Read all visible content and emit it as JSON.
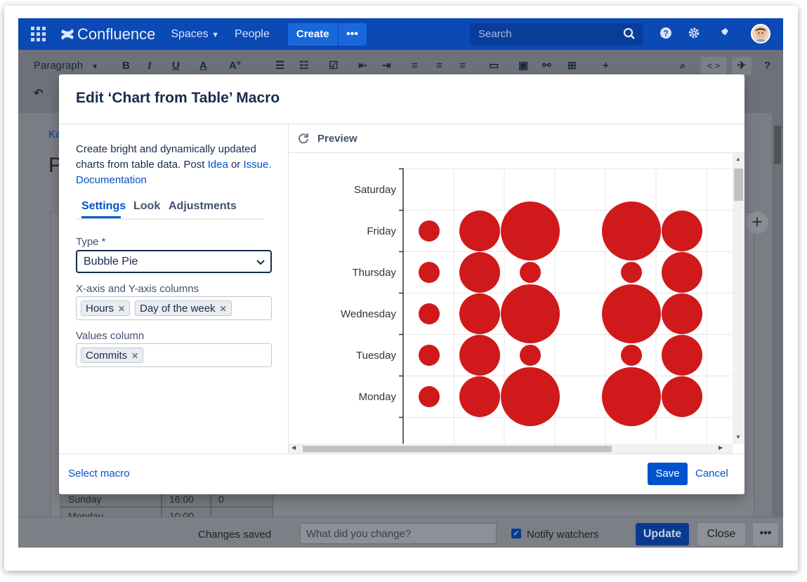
{
  "topnav": {
    "brand": "Confluence",
    "spaces": "Spaces",
    "people": "People",
    "create": "Create",
    "more": "•••",
    "search_placeholder": "Search"
  },
  "toolbar": {
    "paragraph": "Paragraph",
    "bold": "B",
    "italic": "I",
    "underline": "U",
    "color": "A",
    "code": "< >",
    "help": "?"
  },
  "page": {
    "breadcrumb_fragment": "Ka",
    "title_fragment": "P",
    "table_fragment": [
      {
        "day": "Sunday",
        "hours": "16:00",
        "commits": "0"
      },
      {
        "day": "Monday",
        "hours": "10:00",
        "commits": "..."
      }
    ]
  },
  "bottombar": {
    "changes_saved": "Changes saved",
    "comment_placeholder": "What did you change?",
    "notify": "Notify watchers",
    "update": "Update",
    "close": "Close",
    "more": "•••"
  },
  "modal": {
    "title": "Edit ‘Chart from Table’ Macro",
    "description_pre": "Create bright and dynamically updated charts from table data. Post ",
    "idea_link": "Idea",
    "desc_or": " or ",
    "issue_link": "Issue.",
    "documentation_link": "Documentation",
    "tabs": [
      "Settings",
      "Look",
      "Adjustments"
    ],
    "type_label": "Type *",
    "type_value": "Bubble Pie",
    "axes_label": "X-axis and Y-axis columns",
    "axes_tags": [
      "Hours",
      "Day of the week"
    ],
    "values_label": "Values column",
    "values_tags": [
      "Commits"
    ],
    "preview": "Preview",
    "select_macro": "Select macro",
    "save": "Save",
    "cancel": "Cancel"
  },
  "chart_data": {
    "type": "scatter",
    "variant": "bubble",
    "categories": [
      "Monday",
      "Tuesday",
      "Wednesday",
      "Thursday",
      "Friday",
      "Saturday"
    ],
    "bubble_color": "#d0191a",
    "columns": 6,
    "bubbles": [
      {
        "row": "Friday",
        "col": 1,
        "size": 1
      },
      {
        "row": "Friday",
        "col": 2,
        "size": 2
      },
      {
        "row": "Friday",
        "col": 3,
        "size": 3
      },
      {
        "row": "Friday",
        "col": 5,
        "size": 3
      },
      {
        "row": "Friday",
        "col": 6,
        "size": 2
      },
      {
        "row": "Thursday",
        "col": 1,
        "size": 1
      },
      {
        "row": "Thursday",
        "col": 2,
        "size": 2
      },
      {
        "row": "Thursday",
        "col": 3,
        "size": 1
      },
      {
        "row": "Thursday",
        "col": 5,
        "size": 1
      },
      {
        "row": "Thursday",
        "col": 6,
        "size": 2
      },
      {
        "row": "Wednesday",
        "col": 1,
        "size": 1
      },
      {
        "row": "Wednesday",
        "col": 2,
        "size": 2
      },
      {
        "row": "Wednesday",
        "col": 3,
        "size": 3
      },
      {
        "row": "Wednesday",
        "col": 5,
        "size": 3
      },
      {
        "row": "Wednesday",
        "col": 6,
        "size": 2
      },
      {
        "row": "Tuesday",
        "col": 1,
        "size": 1
      },
      {
        "row": "Tuesday",
        "col": 2,
        "size": 2
      },
      {
        "row": "Tuesday",
        "col": 3,
        "size": 1
      },
      {
        "row": "Tuesday",
        "col": 5,
        "size": 1
      },
      {
        "row": "Tuesday",
        "col": 6,
        "size": 2
      },
      {
        "row": "Monday",
        "col": 1,
        "size": 1
      },
      {
        "row": "Monday",
        "col": 2,
        "size": 2
      },
      {
        "row": "Monday",
        "col": 3,
        "size": 3
      },
      {
        "row": "Monday",
        "col": 5,
        "size": 3
      },
      {
        "row": "Monday",
        "col": 6,
        "size": 2
      }
    ]
  }
}
